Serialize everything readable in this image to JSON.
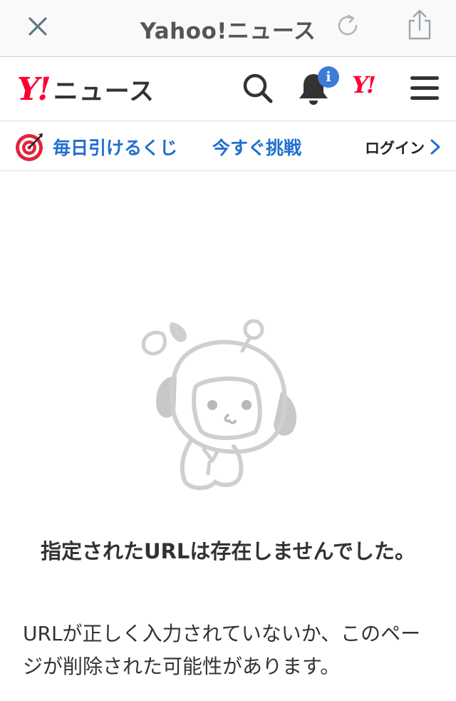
{
  "browser": {
    "title": "Yahoo!ニュース"
  },
  "header": {
    "logo_mark": "Y!",
    "logo_text": "ニュース",
    "notification_badge": "i",
    "yahoo_mark": "Y!"
  },
  "promo": {
    "lottery_label": "毎日引けるくじ",
    "challenge_label": "今すぐ挑戦",
    "login_label": "ログイン"
  },
  "error": {
    "title": "指定されたURLは存在しませんでした。",
    "message": "URLが正しく入力されていないか、このページが削除された可能性があります。"
  },
  "colors": {
    "yahoo_red": "#ff0033",
    "link_blue": "#1f6fcf",
    "badge_blue": "#3c7bd8"
  },
  "icons": [
    "close-icon",
    "reload-icon",
    "share-icon",
    "search-icon",
    "bell-icon",
    "menu-icon",
    "target-icon",
    "chevron-right-icon",
    "mascot-illustration"
  ]
}
